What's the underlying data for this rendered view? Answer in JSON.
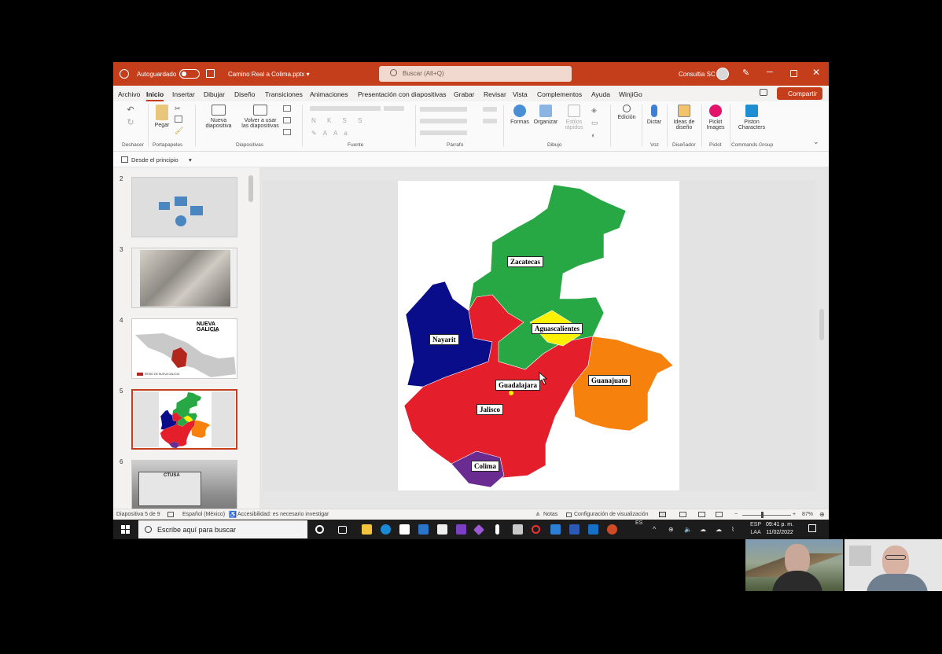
{
  "window": {
    "autosave_label": "Autoguardado",
    "file_name": "Camino Real a Colima.pptx",
    "search_placeholder": "Buscar (Alt+Q)",
    "user_name": "Consultia SC"
  },
  "menu": {
    "tabs": [
      "Archivo",
      "Inicio",
      "Insertar",
      "Dibujar",
      "Diseño",
      "Transiciones",
      "Animaciones",
      "Presentación con diapositivas",
      "Grabar",
      "Revisar",
      "Vista",
      "Complementos",
      "Ayuda",
      "WinjiGo"
    ],
    "active_tab": "Inicio",
    "share_label": "Compartir"
  },
  "ribbon": {
    "paste": "Pegar",
    "new_slide": [
      "Nueva",
      "diapositiva"
    ],
    "reuse_slides": [
      "Volver a usar",
      "las diapositivas"
    ],
    "shapes": "Formas",
    "arrange": "Organizar",
    "quick_styles": [
      "Estilos",
      "rápidos"
    ],
    "editing": "Edición",
    "dictate": "Dictar",
    "design_ideas": [
      "Ideas de",
      "diseño"
    ],
    "pickit": [
      "Pickit",
      "Images"
    ],
    "piston": [
      "Piston",
      "Characters"
    ],
    "groups": {
      "undo": "Deshacer",
      "clipboard": "Portapapeles",
      "slides": "Diapositivas",
      "font": "Fuente",
      "paragraph": "Párrafo",
      "drawing": "Dibujo",
      "voice": "Voz",
      "designer": "Diseñador",
      "pickit": "Pickit",
      "commands": "Commands Group"
    },
    "from_beginning": "Desde el principio"
  },
  "thumbnails": {
    "numbers": [
      "2",
      "3",
      "4",
      "5",
      "6"
    ],
    "slide4_title": "NUEVA GALICIA",
    "slide4_year": "1548",
    "slide4_legend": "REINO DE NUEVA GALICIA",
    "slide6_text": "CTUSA",
    "selected": "5"
  },
  "map": {
    "colors": {
      "zacatecas": "#27a844",
      "nayarit": "#0a0d8a",
      "jalisco": "#e41e2a",
      "aguascalientes": "#fff200",
      "guanajuato": "#f7810d",
      "colima": "#6a2c91"
    },
    "labels": {
      "zacatecas": "Zacatecas",
      "aguascalientes": "Aguascalientes",
      "nayarit": "Nayarit",
      "guadalajara": "Guadalajara",
      "guanajuato": "Guanajuato",
      "jalisco": "Jalisco",
      "colima": "Colima"
    }
  },
  "status": {
    "slide_counter": "Diapositiva 5 de 9",
    "language": "Español (México)",
    "accessibility": "Accesibilidad: es necesario investigar",
    "notes": "Notas",
    "view_settings": "Configuración de visualización",
    "zoom": "87%"
  },
  "taskbar": {
    "search_placeholder": "Escribe aquí para buscar",
    "lang_top": "ESP",
    "lang_bottom": "LAA",
    "ime": "ES",
    "time": "09:41 p. m.",
    "date": "11/02/2022"
  }
}
